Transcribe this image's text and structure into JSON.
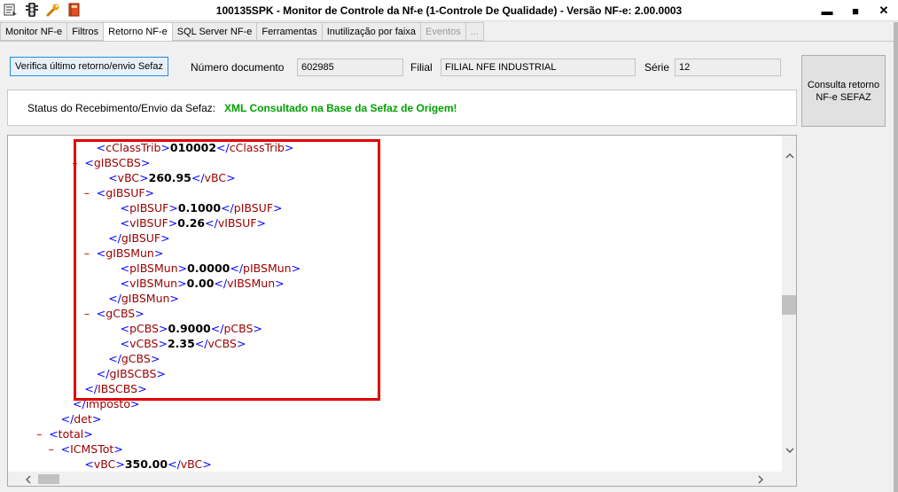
{
  "window": {
    "title": "100135SPK - Monitor de Controle da Nf-e (1-Controle De Qualidade) - Versão NF-e: 2.00.0003",
    "toolbar_icons": [
      "app-menu-icon",
      "traffic-light-icon",
      "wrench-icon",
      "book-icon"
    ],
    "controls": {
      "minimize": "▬",
      "maximize": "■",
      "close": "✕"
    }
  },
  "tabs": [
    {
      "label": "Monitor NF-e",
      "active": false,
      "disabled": false
    },
    {
      "label": "Filtros",
      "active": false,
      "disabled": false
    },
    {
      "label": "Retorno NF-e",
      "active": true,
      "disabled": false
    },
    {
      "label": "SQL Server NF-e",
      "active": false,
      "disabled": false
    },
    {
      "label": "Ferramentas",
      "active": false,
      "disabled": false
    },
    {
      "label": "Inutilização por faixa",
      "active": false,
      "disabled": false
    },
    {
      "label": "Eventos",
      "active": false,
      "disabled": true
    },
    {
      "label": "...",
      "active": false,
      "disabled": true
    }
  ],
  "form": {
    "verifica_button": "Verifica último retorno/envio Sefaz",
    "numero_label": "Número documento",
    "numero_value": "602985",
    "filial_label": "Filial",
    "filial_value": "FILIAL NFE INDUSTRIAL",
    "serie_label": "Série",
    "serie_value": "12",
    "consulta_button": "Consulta retorno NF-e SEFAZ"
  },
  "status": {
    "label": "Status do Recebimento/Envio da Sefaz:",
    "value": "XML Consultado na Base da Sefaz de Origem!",
    "color": "#00a000"
  },
  "xml": {
    "lines": [
      {
        "indent": 7,
        "marker": "",
        "open": "cClassTrib",
        "value": "010002",
        "close": "cClassTrib"
      },
      {
        "indent": 6,
        "marker": "–",
        "open": "gIBSCBS",
        "value": "",
        "close": ""
      },
      {
        "indent": 8,
        "marker": "",
        "open": "vBC",
        "value": "260.95",
        "close": "vBC"
      },
      {
        "indent": 7,
        "marker": "–",
        "open": "gIBSUF",
        "value": "",
        "close": ""
      },
      {
        "indent": 9,
        "marker": "",
        "open": "pIBSUF",
        "value": "0.1000",
        "close": "pIBSUF"
      },
      {
        "indent": 9,
        "marker": "",
        "open": "vIBSUF",
        "value": "0.26",
        "close": "vIBSUF"
      },
      {
        "indent": 8,
        "marker": "",
        "open": "",
        "value": "",
        "close": "gIBSUF"
      },
      {
        "indent": 7,
        "marker": "–",
        "open": "gIBSMun",
        "value": "",
        "close": ""
      },
      {
        "indent": 9,
        "marker": "",
        "open": "pIBSMun",
        "value": "0.0000",
        "close": "pIBSMun"
      },
      {
        "indent": 9,
        "marker": "",
        "open": "vIBSMun",
        "value": "0.00",
        "close": "vIBSMun"
      },
      {
        "indent": 8,
        "marker": "",
        "open": "",
        "value": "",
        "close": "gIBSMun"
      },
      {
        "indent": 7,
        "marker": "–",
        "open": "gCBS",
        "value": "",
        "close": ""
      },
      {
        "indent": 9,
        "marker": "",
        "open": "pCBS",
        "value": "0.9000",
        "close": "pCBS"
      },
      {
        "indent": 9,
        "marker": "",
        "open": "vCBS",
        "value": "2.35",
        "close": "vCBS"
      },
      {
        "indent": 8,
        "marker": "",
        "open": "",
        "value": "",
        "close": "gCBS"
      },
      {
        "indent": 7,
        "marker": "",
        "open": "",
        "value": "",
        "close": "gIBSCBS"
      },
      {
        "indent": 6,
        "marker": "",
        "open": "",
        "value": "",
        "close": "IBSCBS"
      },
      {
        "indent": 5,
        "marker": "",
        "open": "",
        "value": "",
        "close": "imposto"
      },
      {
        "indent": 4,
        "marker": "",
        "open": "",
        "value": "",
        "close": "det"
      },
      {
        "indent": 3,
        "marker": "–",
        "open": "total",
        "value": "",
        "close": ""
      },
      {
        "indent": 4,
        "marker": "–",
        "open": "ICMSTot",
        "value": "",
        "close": ""
      },
      {
        "indent": 6,
        "marker": "",
        "open": "vBC",
        "value": "350.00",
        "close": "vBC"
      }
    ]
  },
  "highlight_color": "#e00000"
}
